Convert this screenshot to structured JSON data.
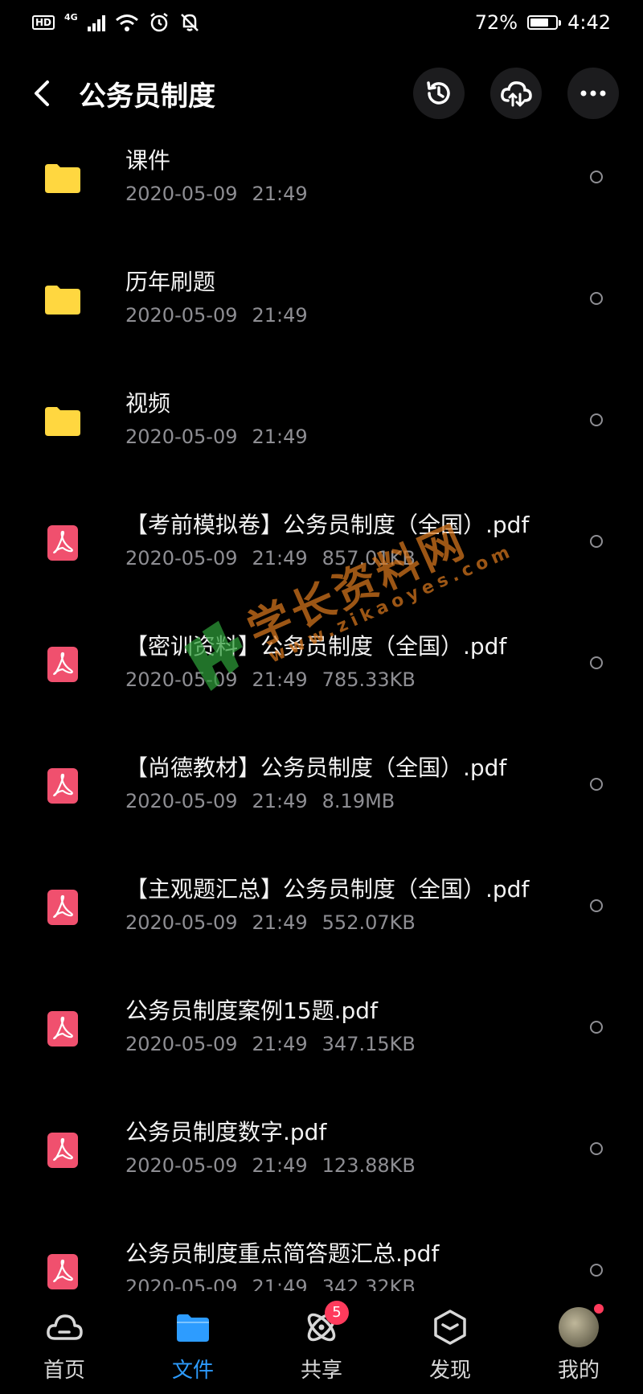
{
  "status_bar": {
    "hd": "HD",
    "network": "4G",
    "battery_text": "72%",
    "battery_level": 0.72,
    "time": "4:42"
  },
  "header": {
    "title": "公务员制度",
    "icons": [
      "back-arrow-icon",
      "history-icon",
      "cloud-transfer-icon",
      "more-icon"
    ]
  },
  "files": [
    {
      "name": "课件",
      "date": "2020-05-09",
      "time": "21:49",
      "size": "",
      "type": "folder"
    },
    {
      "name": "历年刷题",
      "date": "2020-05-09",
      "time": "21:49",
      "size": "",
      "type": "folder"
    },
    {
      "name": "视频",
      "date": "2020-05-09",
      "time": "21:49",
      "size": "",
      "type": "folder"
    },
    {
      "name": "【考前模拟卷】公务员制度（全国）.pdf",
      "date": "2020-05-09",
      "time": "21:49",
      "size": "857.01KB",
      "type": "pdf"
    },
    {
      "name": "【密训资料】公务员制度（全国）.pdf",
      "date": "2020-05-09",
      "time": "21:49",
      "size": "785.33KB",
      "type": "pdf"
    },
    {
      "name": "【尚德教材】公务员制度（全国）.pdf",
      "date": "2020-05-09",
      "time": "21:49",
      "size": "8.19MB",
      "type": "pdf"
    },
    {
      "name": "【主观题汇总】公务员制度（全国）.pdf",
      "date": "2020-05-09",
      "time": "21:49",
      "size": "552.07KB",
      "type": "pdf"
    },
    {
      "name": "公务员制度案例15题.pdf",
      "date": "2020-05-09",
      "time": "21:49",
      "size": "347.15KB",
      "type": "pdf"
    },
    {
      "name": "公务员制度数字.pdf",
      "date": "2020-05-09",
      "time": "21:49",
      "size": "123.88KB",
      "type": "pdf"
    },
    {
      "name": "公务员制度重点简答题汇总.pdf",
      "date": "2020-05-09",
      "time": "21:49",
      "size": "342.32KB",
      "type": "pdf"
    }
  ],
  "watermark": {
    "text": "学长资料网",
    "url": "www.zikaoyes.com"
  },
  "nav": {
    "items": [
      {
        "label": "首页",
        "icon": "cloud-home-icon"
      },
      {
        "label": "文件",
        "icon": "folder-icon"
      },
      {
        "label": "共享",
        "icon": "share-orbit-icon",
        "badge": "5"
      },
      {
        "label": "发现",
        "icon": "discover-box-icon"
      },
      {
        "label": "我的",
        "icon": "avatar"
      }
    ],
    "active": "文件"
  },
  "colors": {
    "background": "#000000",
    "folder": "#ffd740",
    "pdf": "#f0506e",
    "accent": "#2d9cff",
    "badge": "#ff3b5c",
    "secondary_text": "#8e8e93"
  }
}
